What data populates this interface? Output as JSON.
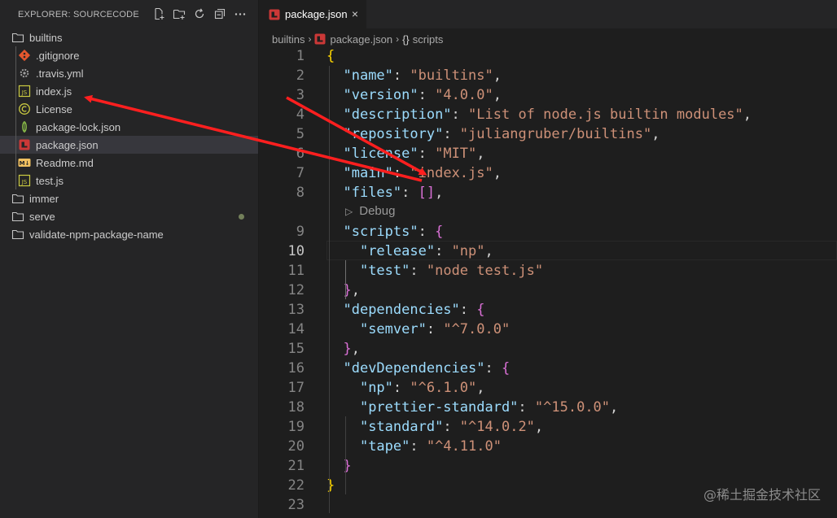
{
  "sidebar": {
    "title": "EXPLORER: SOURCECODE",
    "actions": [
      {
        "name": "new-file-icon"
      },
      {
        "name": "new-folder-icon"
      },
      {
        "name": "refresh-icon"
      },
      {
        "name": "collapse-all-icon"
      },
      {
        "name": "more-actions-icon"
      }
    ],
    "tree": [
      {
        "label": "builtins",
        "kind": "folder",
        "level": 0
      },
      {
        "label": ".gitignore",
        "kind": "git",
        "level": 1
      },
      {
        "label": ".travis.yml",
        "kind": "gear",
        "level": 1
      },
      {
        "label": "index.js",
        "kind": "js",
        "level": 1
      },
      {
        "label": "License",
        "kind": "license",
        "level": 1
      },
      {
        "label": "package-lock.json",
        "kind": "npm-lock",
        "level": 1
      },
      {
        "label": "package.json",
        "kind": "npm",
        "level": 1,
        "selected": true
      },
      {
        "label": "Readme.md",
        "kind": "md",
        "level": 1
      },
      {
        "label": "test.js",
        "kind": "js",
        "level": 1
      },
      {
        "label": "immer",
        "kind": "folder",
        "level": 0
      },
      {
        "label": "serve",
        "kind": "folder",
        "level": 0,
        "modified": true
      },
      {
        "label": "validate-npm-package-name",
        "kind": "folder",
        "level": 0
      }
    ]
  },
  "tab": {
    "label": "package.json",
    "close": "×"
  },
  "breadcrumb": {
    "folder": "builtins",
    "file": "package.json",
    "symbol_braces": "{}",
    "symbol": "scripts"
  },
  "editor": {
    "codelens": "Debug",
    "active_line": 10,
    "lines": [
      {
        "n": "1",
        "code": "{"
      },
      {
        "n": "2",
        "code": "  \"name\": \"builtins\","
      },
      {
        "n": "3",
        "code": "  \"version\": \"4.0.0\","
      },
      {
        "n": "4",
        "code": "  \"description\": \"List of node.js builtin modules\","
      },
      {
        "n": "5",
        "code": "  \"repository\": \"juliangruber/builtins\","
      },
      {
        "n": "6",
        "code": "  \"license\": \"MIT\","
      },
      {
        "n": "7",
        "code": "  \"main\": \"index.js\","
      },
      {
        "n": "8",
        "code": "  \"files\": [],"
      },
      {
        "n": "9",
        "code": "  \"scripts\": {"
      },
      {
        "n": "10",
        "code": "    \"release\": \"np\","
      },
      {
        "n": "11",
        "code": "    \"test\": \"node test.js\""
      },
      {
        "n": "12",
        "code": "  },"
      },
      {
        "n": "13",
        "code": "  \"dependencies\": {"
      },
      {
        "n": "14",
        "code": "    \"semver\": \"^7.0.0\""
      },
      {
        "n": "15",
        "code": "  },"
      },
      {
        "n": "16",
        "code": "  \"devDependencies\": {"
      },
      {
        "n": "17",
        "code": "    \"np\": \"^6.1.0\","
      },
      {
        "n": "18",
        "code": "    \"prettier-standard\": \"^15.0.0\","
      },
      {
        "n": "19",
        "code": "    \"standard\": \"^14.0.2\","
      },
      {
        "n": "20",
        "code": "    \"tape\": \"^4.11.0\""
      },
      {
        "n": "21",
        "code": "  }"
      },
      {
        "n": "22",
        "code": "}"
      },
      {
        "n": "23",
        "code": ""
      }
    ]
  },
  "annotations": {
    "arrow_color": "#ff1f1f"
  },
  "colors": {
    "key": "#9cdcfe",
    "string": "#ce9178",
    "bracket1": "#ffd700",
    "bracket2": "#da70d6",
    "bracket3": "#179fff"
  },
  "watermark": "@稀土掘金技术社区"
}
